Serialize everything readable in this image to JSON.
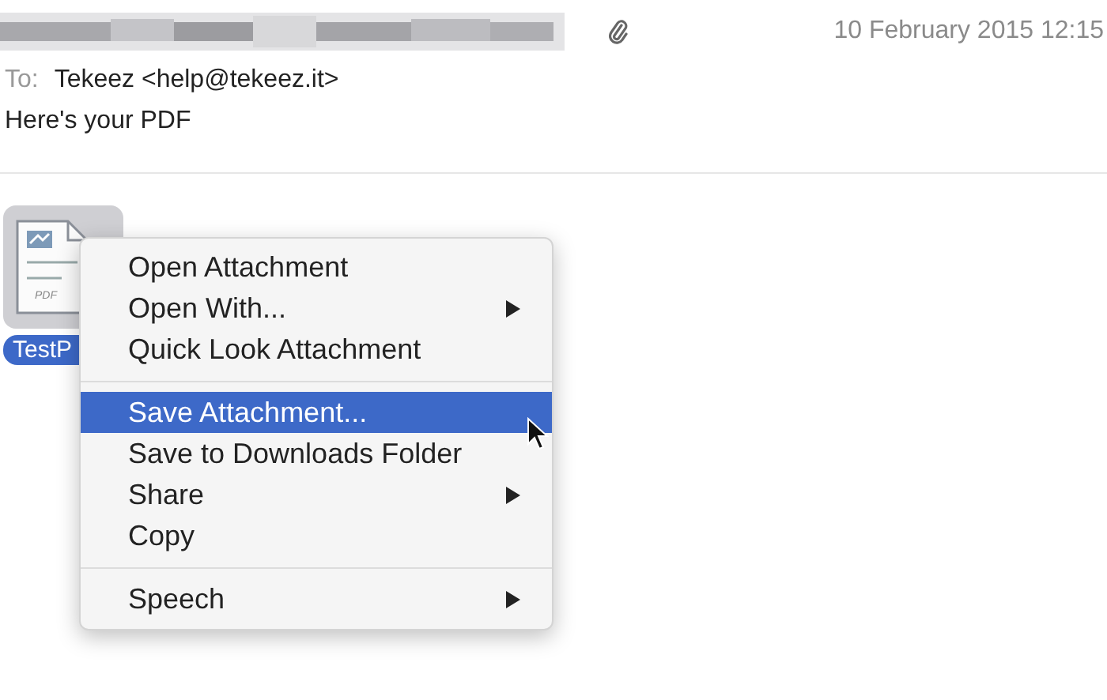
{
  "header": {
    "date": "10 February 2015 12:15",
    "to_label": "To:",
    "to_value": "Tekeez <help@tekeez.it>",
    "subject": "Here's your PDF",
    "has_attachment_icon": true
  },
  "attachment": {
    "file_type": "PDF",
    "filename": "TestP",
    "selected": true
  },
  "context_menu": {
    "items": [
      {
        "kind": "item",
        "label": "Open Attachment",
        "submenu": false,
        "selected": false
      },
      {
        "kind": "item",
        "label": "Open With...",
        "submenu": true,
        "selected": false
      },
      {
        "kind": "item",
        "label": "Quick Look Attachment",
        "submenu": false,
        "selected": false
      },
      {
        "kind": "separator"
      },
      {
        "kind": "item",
        "label": "Save Attachment...",
        "submenu": false,
        "selected": true
      },
      {
        "kind": "item",
        "label": "Save to Downloads Folder",
        "submenu": false,
        "selected": false
      },
      {
        "kind": "item",
        "label": "Share",
        "submenu": true,
        "selected": false
      },
      {
        "kind": "item",
        "label": "Copy",
        "submenu": false,
        "selected": false
      },
      {
        "kind": "separator"
      },
      {
        "kind": "item",
        "label": "Speech",
        "submenu": true,
        "selected": false
      }
    ]
  }
}
